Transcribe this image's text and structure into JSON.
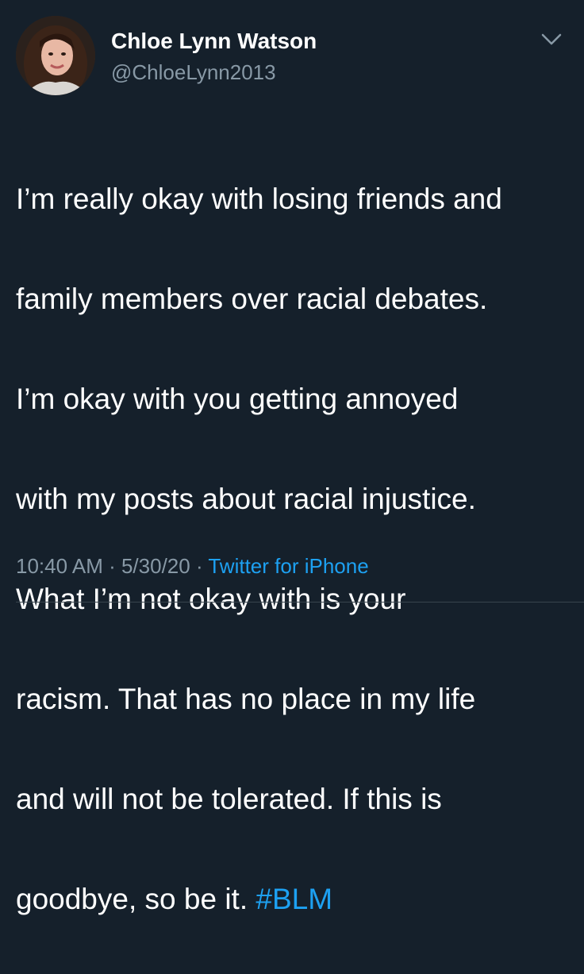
{
  "user": {
    "display_name": "Chloe Lynn Watson",
    "handle": "@ChloeLynn2013"
  },
  "tweet": {
    "lines": [
      "I’m really okay with losing friends and",
      "family members over racial debates.",
      "I’m okay with you getting annoyed",
      "with my posts about racial injustice.",
      "What I’m not okay with is your",
      "racism. That has no place in my life",
      "and will not be tolerated. If this is",
      "goodbye, so be it. "
    ],
    "hashtag": "#BLM"
  },
  "meta": {
    "time": "10:40 AM",
    "separator": " · ",
    "date": "5/30/20",
    "source": "Twitter for iPhone"
  },
  "icons": {
    "menu": "chevron-down-icon"
  },
  "colors": {
    "background": "#15202b",
    "text": "#ffffff",
    "secondary": "#8899a6",
    "link": "#1da1f2"
  }
}
